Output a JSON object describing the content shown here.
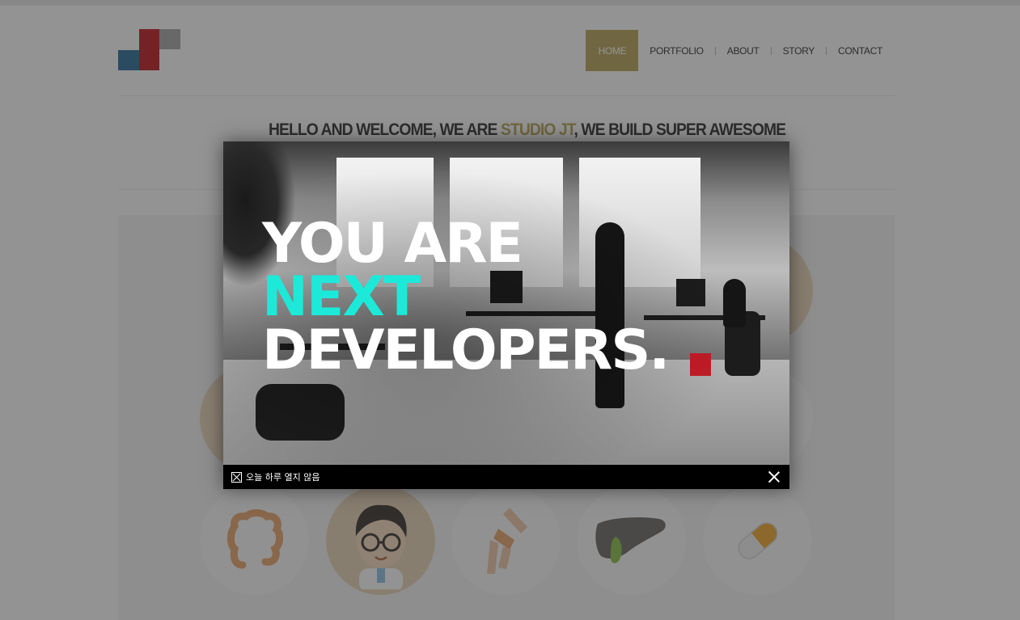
{
  "nav": {
    "items": [
      {
        "label": "HOME",
        "active": true
      },
      {
        "label": "PORTFOLIO",
        "active": false
      },
      {
        "label": "ABOUT",
        "active": false
      },
      {
        "label": "STORY",
        "active": false
      },
      {
        "label": "CONTACT",
        "active": false
      }
    ]
  },
  "hero": {
    "headline_pre": "HELLO AND WELCOME, WE ARE ",
    "headline_highlight": "STUDIO JT",
    "headline_post": ", WE BUILD SUPER AWESOME"
  },
  "popup": {
    "line1": "YOU ARE",
    "line2": "NEXT",
    "line3": "DEVELOPERS.",
    "dont_show_label": "오늘 하루 열지 않음"
  },
  "colors": {
    "accent_gold": "#b8a75c",
    "accent_teal": "#1de9d9",
    "logo_red": "#c21c26",
    "logo_blue": "#2f6e9c"
  },
  "icons": [
    "intestine-icon",
    "doctor-avatar-icon",
    "knee-joint-icon",
    "liver-icon",
    "pill-icon"
  ]
}
